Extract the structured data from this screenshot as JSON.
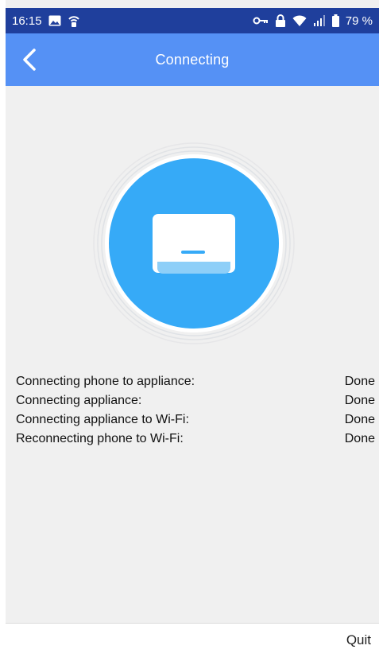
{
  "status_bar": {
    "time": "16:15",
    "battery_percent": "79 %",
    "icons_left": [
      "image-icon",
      "wifi-hotspot-icon"
    ],
    "icons_right": [
      "vpn-key-icon",
      "lock-icon",
      "wifi-icon",
      "signal-icon",
      "battery-icon"
    ]
  },
  "header": {
    "title": "Connecting",
    "back_icon": "chevron-left-icon"
  },
  "hero": {
    "icon": "air-conditioner-icon",
    "color": "#36aaf7"
  },
  "steps": [
    {
      "label": "Connecting phone to appliance:",
      "status": "Done"
    },
    {
      "label": "Connecting appliance:",
      "status": "Done"
    },
    {
      "label": "Connecting appliance to Wi-Fi:",
      "status": "Done"
    },
    {
      "label": "Reconnecting phone to Wi-Fi:",
      "status": "Done"
    }
  ],
  "footer": {
    "quit_label": "Quit"
  },
  "colors": {
    "status_bar": "#1f3f9c",
    "app_bar": "#5591f5",
    "background": "#f0f0f0"
  }
}
